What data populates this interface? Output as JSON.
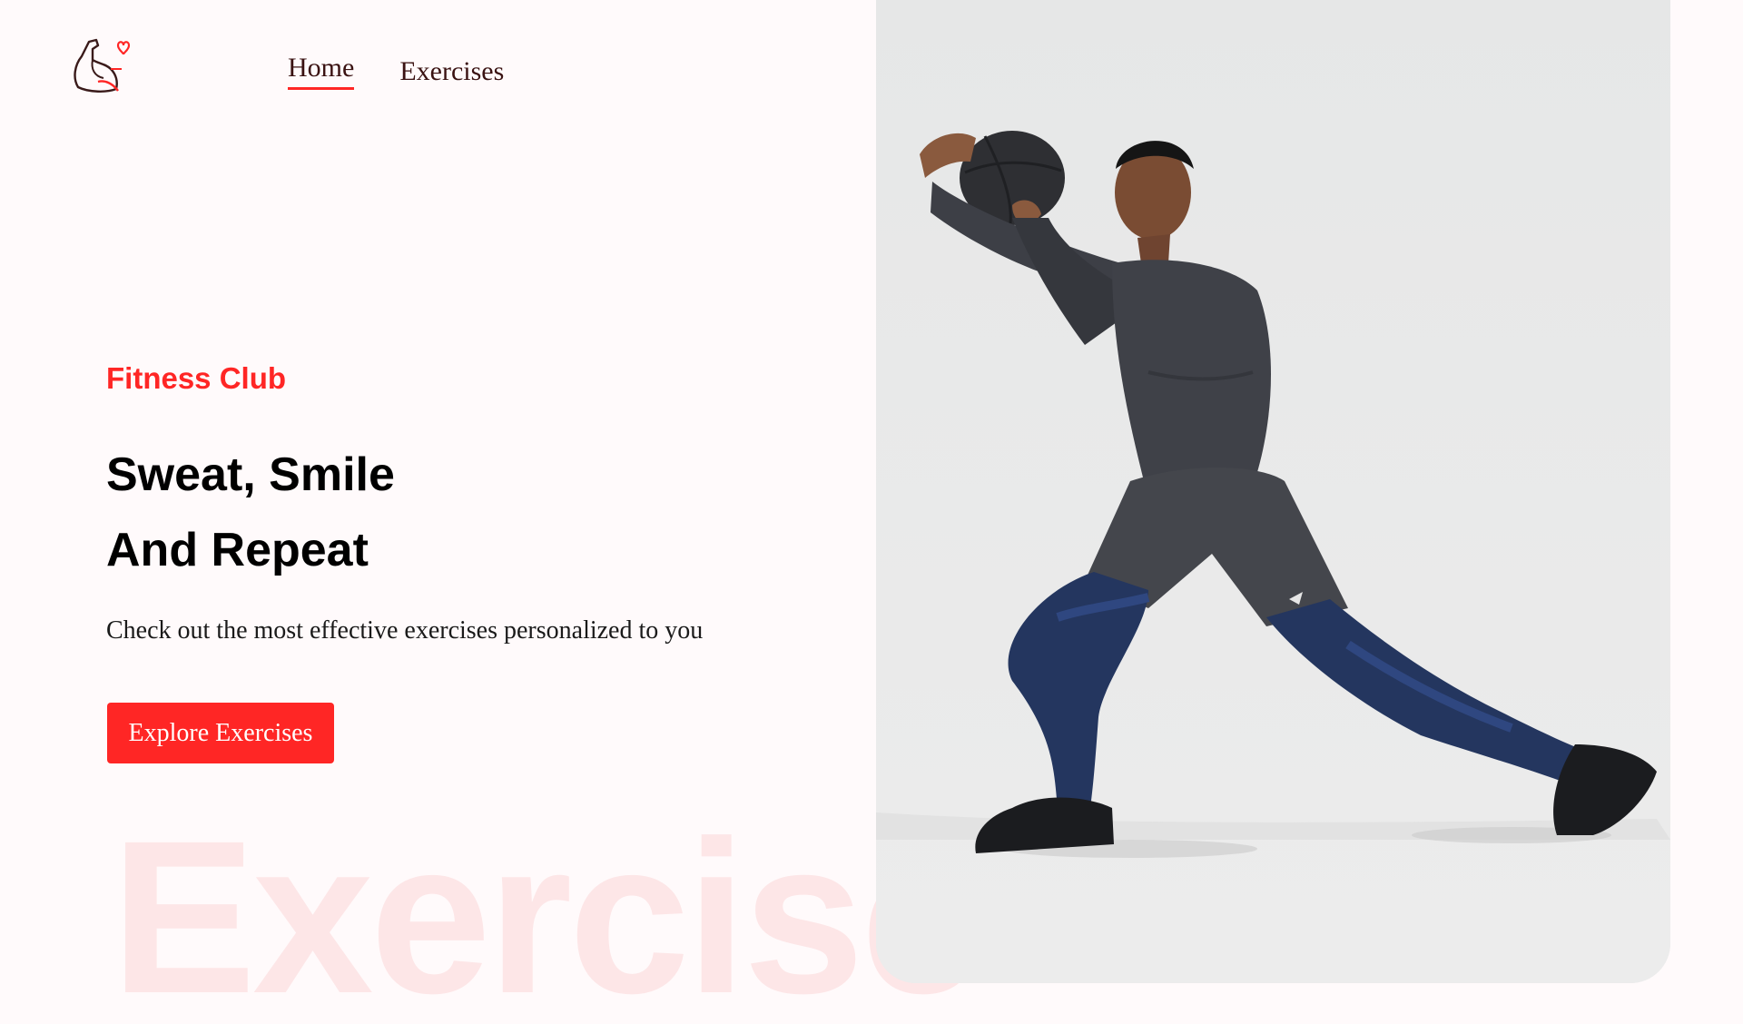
{
  "nav": {
    "items": [
      {
        "label": "Home",
        "active": true
      },
      {
        "label": "Exercises",
        "active": false
      }
    ]
  },
  "hero": {
    "eyebrow": "Fitness Club",
    "headline_line1": "Sweat, Smile",
    "headline_line2": "And Repeat",
    "subtext": "Check out the most effective exercises personalized to you",
    "cta_label": "Explore Exercises",
    "watermark": "Exercise"
  },
  "colors": {
    "accent": "#ff2625",
    "background": "#fffafb",
    "watermark": "#fde6e7",
    "panel": "#e8e8e8"
  },
  "icons": {
    "logo": "flexing-arm-heart-icon"
  }
}
